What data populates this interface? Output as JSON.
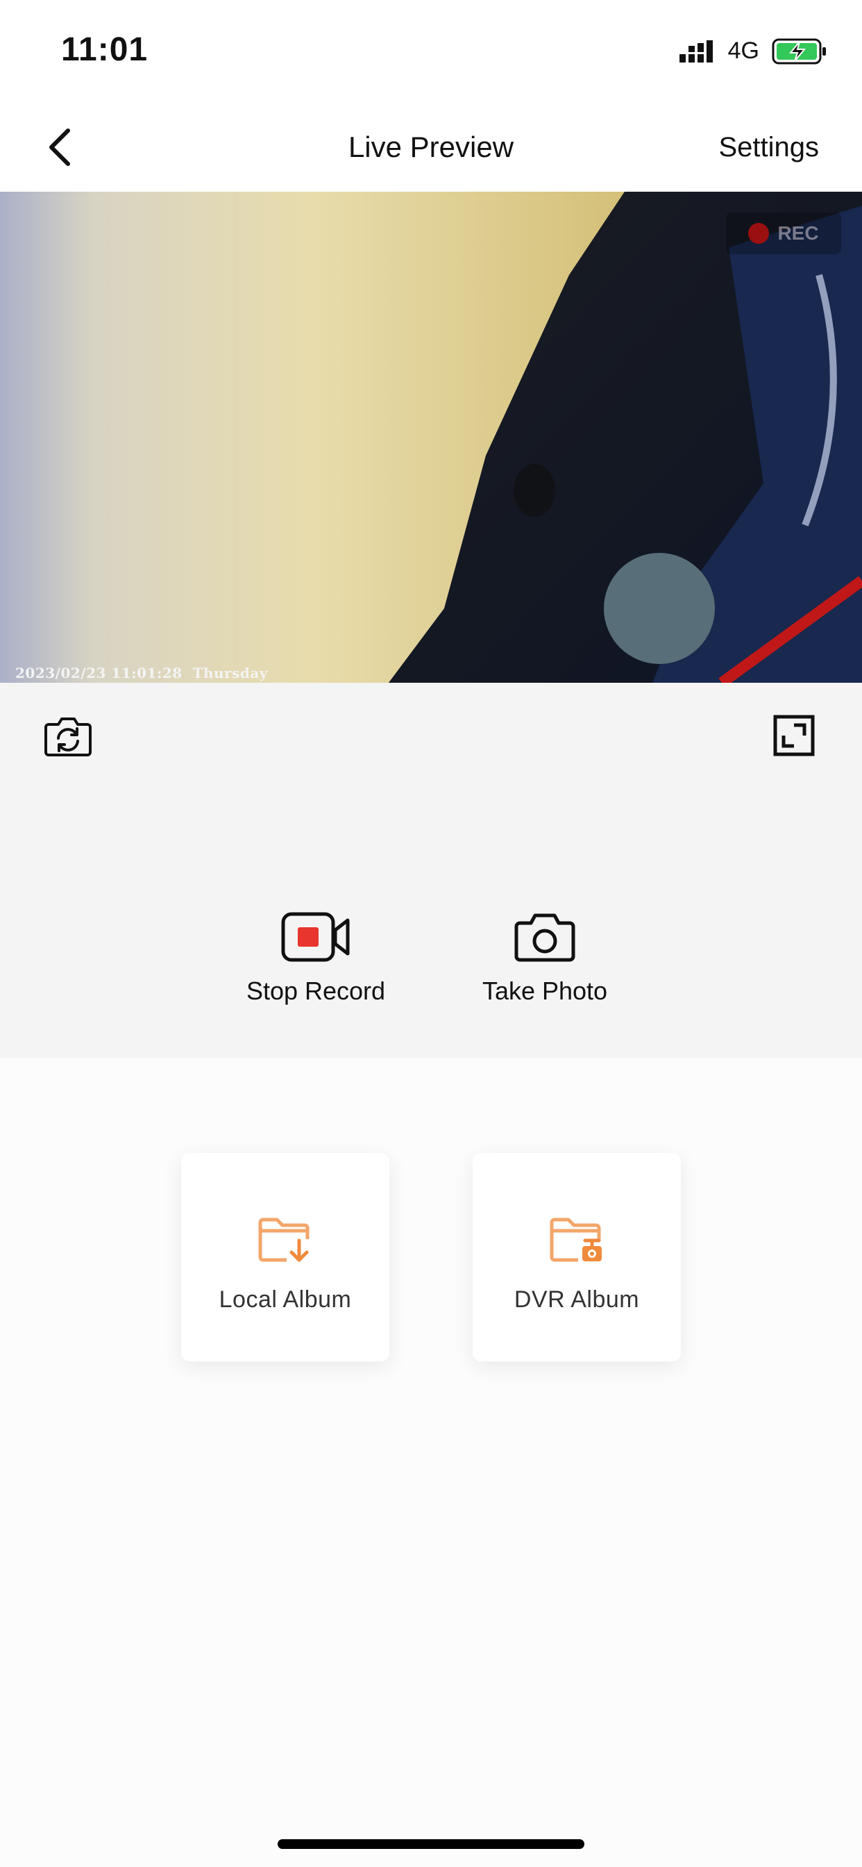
{
  "status_bar": {
    "time": "11:01",
    "network": "4G",
    "signal_icon": "signal-bars-icon",
    "battery_icon": "battery-charging-icon",
    "battery_color": "#34c759"
  },
  "nav": {
    "back_icon": "chevron-left-icon",
    "title": "Live Preview",
    "settings_label": "Settings"
  },
  "preview": {
    "rec_label": "REC",
    "rec_color": "#9a1010",
    "timestamp": "2023/02/23 11:01:28  Thursday"
  },
  "controls": {
    "switch_camera_icon": "switch-camera-icon",
    "fullscreen_icon": "fullscreen-icon",
    "stop_record_label": "Stop Record",
    "stop_record_icon": "video-record-icon",
    "record_accent": "#e8352d",
    "take_photo_label": "Take Photo",
    "take_photo_icon": "camera-icon"
  },
  "albums": {
    "local_label": "Local Album",
    "local_icon": "folder-download-icon",
    "dvr_label": "DVR Album",
    "dvr_icon": "folder-dashcam-icon",
    "accent": "#f08a3c"
  }
}
